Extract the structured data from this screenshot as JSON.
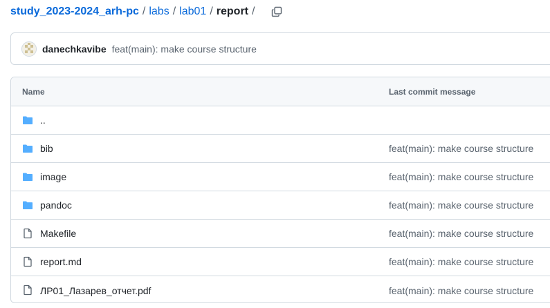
{
  "breadcrumb": {
    "repo": "study_2023-2024_arh-pc",
    "path": [
      "labs",
      "lab01"
    ],
    "current": "report",
    "separator": "/"
  },
  "latest_commit": {
    "author": "danechkavibe",
    "message": "feat(main): make course structure"
  },
  "table": {
    "headers": {
      "name": "Name",
      "last_commit": "Last commit message"
    },
    "rows": [
      {
        "name": "..",
        "type": "folder",
        "message": ""
      },
      {
        "name": "bib",
        "type": "folder",
        "message": "feat(main): make course structure"
      },
      {
        "name": "image",
        "type": "folder",
        "message": "feat(main): make course structure"
      },
      {
        "name": "pandoc",
        "type": "folder",
        "message": "feat(main): make course structure"
      },
      {
        "name": "Makefile",
        "type": "file",
        "message": "feat(main): make course structure"
      },
      {
        "name": "report.md",
        "type": "file",
        "message": "feat(main): make course structure"
      },
      {
        "name": "ЛР01_Лазарев_отчет.pdf",
        "type": "file",
        "message": "feat(main): make course structure"
      }
    ]
  },
  "icons": {
    "folder": "folder-icon",
    "file": "file-icon",
    "copy": "copy-icon"
  },
  "colors": {
    "link": "#0969da",
    "folder": "#54aeff",
    "muted": "#59636e",
    "border": "#d1d9e0"
  }
}
